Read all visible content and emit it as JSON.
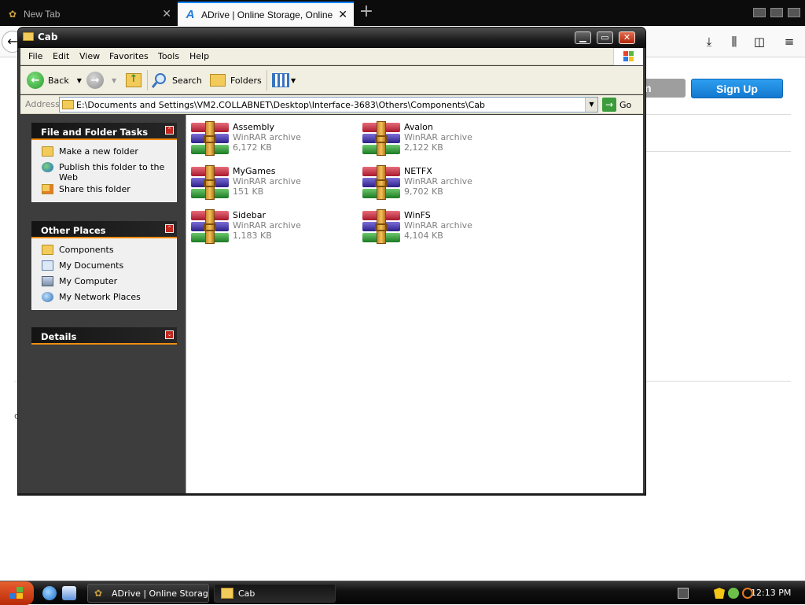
{
  "browser": {
    "tabs": [
      {
        "title": "New Tab",
        "active": false
      },
      {
        "title": "ADrive | Online Storage, Online Ba",
        "active": true
      }
    ],
    "new_tab_symbol": "+",
    "close_symbol": "✕",
    "toolbar_icons": [
      "download-icon",
      "library-icon",
      "sidebar-icon",
      "menu-icon"
    ]
  },
  "page": {
    "login_fragment": "n",
    "signup_label": "Sign Up",
    "stray_char": "c",
    "signup_color": "#1378cf"
  },
  "window": {
    "title": "Cab",
    "menu": [
      "File",
      "Edit",
      "View",
      "Favorites",
      "Tools",
      "Help"
    ],
    "toolbar": {
      "back": "Back",
      "search": "Search",
      "folders": "Folders"
    },
    "address": {
      "label": "Address",
      "path": "E:\\Documents and Settings\\VM2.COLLABNET\\Desktop\\Interface-3683\\Others\\Components\\Cab",
      "go": "Go"
    },
    "accent_color": "#f08c12"
  },
  "taskpane": {
    "file_tasks": {
      "title": "File and Folder Tasks",
      "items": [
        {
          "label": "Make a new folder",
          "icon": "new-folder-icon"
        },
        {
          "label": "Publish this folder to the Web",
          "icon": "publish-web-icon"
        },
        {
          "label": "Share this folder",
          "icon": "share-folder-icon"
        }
      ]
    },
    "other_places": {
      "title": "Other Places",
      "items": [
        {
          "label": "Components",
          "icon": "folder-icon"
        },
        {
          "label": "My Documents",
          "icon": "my-documents-icon"
        },
        {
          "label": "My Computer",
          "icon": "my-computer-icon"
        },
        {
          "label": "My Network Places",
          "icon": "network-places-icon"
        }
      ]
    },
    "details": {
      "title": "Details"
    }
  },
  "files": [
    {
      "name": "Assembly",
      "type": "WinRAR archive",
      "size": "6,172 KB"
    },
    {
      "name": "Avalon",
      "type": "WinRAR archive",
      "size": "2,122 KB"
    },
    {
      "name": "MyGames",
      "type": "WinRAR archive",
      "size": "151 KB"
    },
    {
      "name": "NETFX",
      "type": "WinRAR archive",
      "size": "9,702 KB"
    },
    {
      "name": "Sidebar",
      "type": "WinRAR archive",
      "size": "1,183 KB"
    },
    {
      "name": "WinFS",
      "type": "WinRAR archive",
      "size": "4,104 KB"
    }
  ],
  "taskbar": {
    "tasks": [
      {
        "label": "ADrive | Online Storag...",
        "active": false
      },
      {
        "label": "Cab",
        "active": true
      }
    ],
    "clock": "12:13 PM"
  }
}
